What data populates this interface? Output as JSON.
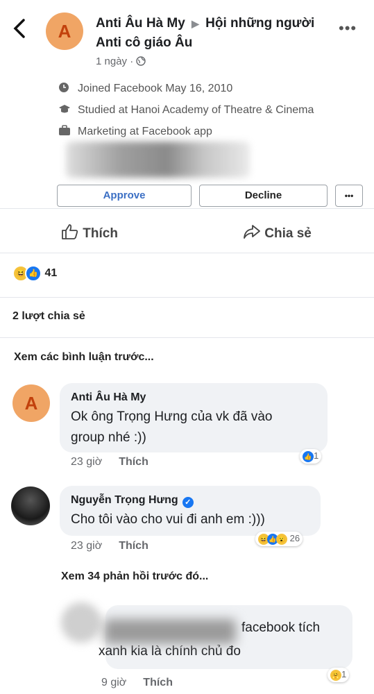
{
  "header": {
    "back_icon": "back-arrow-icon",
    "avatar_letter": "A",
    "author": "Anti Âu Hà My",
    "group": "Hội những người Anti cô giáo Âu",
    "time": "1 ngày",
    "privacy_icon": "globe-icon",
    "more_icon": "more-dots-icon"
  },
  "profile_card": {
    "joined": "Joined Facebook May 16, 2010",
    "studied": "Studied at Hanoi Academy of Theatre & Cinema",
    "work": "Marketing at Facebook app",
    "approve_label": "Approve",
    "decline_label": "Decline",
    "more_label": "•••"
  },
  "actions": {
    "like_label": "Thích",
    "share_label": "Chia sẻ"
  },
  "reactions": {
    "count": "41",
    "icons": [
      "haha-icon",
      "like-icon"
    ]
  },
  "shares": "2 lượt chia sẻ",
  "view_previous": "Xem các bình luận trước...",
  "comments": [
    {
      "avatar_letter": "A",
      "name": "Anti Âu Hà My",
      "text_line1": "Ok ông Trọng Hưng của vk đã vào",
      "text_line2": "group nhé :))",
      "time": "23 giờ",
      "like_label": "Thích",
      "reaction_count": "1"
    },
    {
      "name": "Nguyễn Trọng Hưng",
      "text": "Cho tôi vào cho vui đi anh em :)))",
      "time": "23 giờ",
      "like_label": "Thích",
      "reaction_count": "26"
    }
  ],
  "view_more_replies": "Xem 34 phản hồi trước đó...",
  "reply": {
    "text_line1": "facebook tích",
    "text_line2": "xanh kia là chính chủ đo",
    "time": "9 giờ",
    "like_label": "Thích",
    "reaction_count": "1"
  },
  "colors": {
    "accent": "#1877f2",
    "avatar": "#f0a565",
    "bubble": "#f0f2f5"
  }
}
